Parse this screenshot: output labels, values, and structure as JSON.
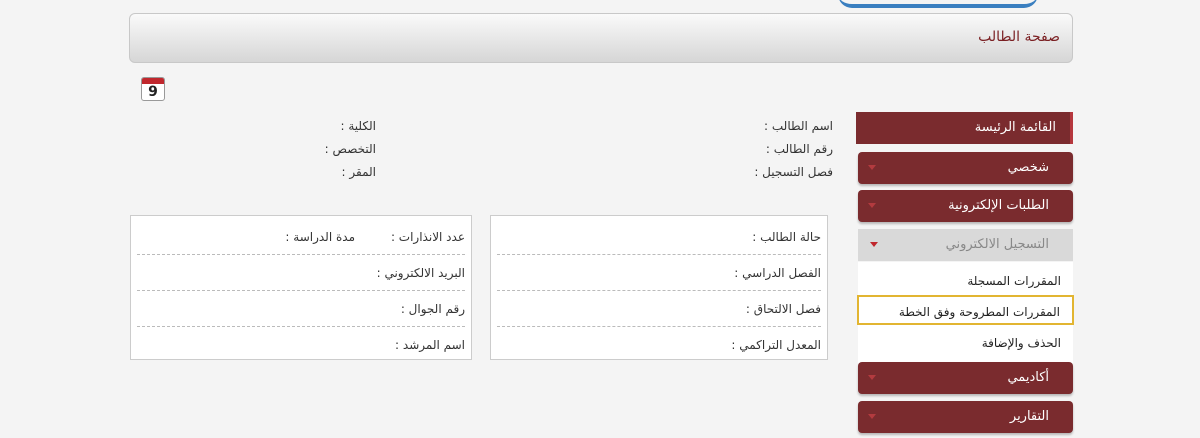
{
  "page_title": "صفحة الطالب",
  "calendar_day": "9",
  "student_info": {
    "name_label": "اسم الطالب :",
    "number_label": "رقم الطالب :",
    "term_label": "فصل التسجيل :",
    "college_label": "الكلية :",
    "major_label": "التخصص :",
    "course_label": "المقر :"
  },
  "panel_right": {
    "rows": [
      "حالة الطالب :",
      "الفصل الدراسي :",
      "فصل الالتحاق :",
      "المعدل التراكمي :"
    ]
  },
  "panel_left": {
    "warnings_label": "عدد الانذارات :",
    "duration_label": "مدة الدراسة :",
    "email_label": "البريد الالكتروني :",
    "mobile_label": "رقم الجوال :",
    "advisor_label": "اسم المرشد :"
  },
  "sidebar": {
    "header": "القائمة الرئيسة",
    "items": [
      "شخصي",
      "الطلبات الإلكترونية"
    ],
    "open_item": "التسجيل الالكتروني",
    "submenu": [
      "المقررات المسجلة",
      "المقررات المطروحة وفق الخطة",
      "الحذف والإضافة"
    ],
    "bottom_items": [
      "أكاديمي",
      "التقارير"
    ]
  },
  "colors": {
    "menu_bg": "#7a2b2e",
    "highlight_border": "#e2b531",
    "title_color": "#7a1f22"
  }
}
